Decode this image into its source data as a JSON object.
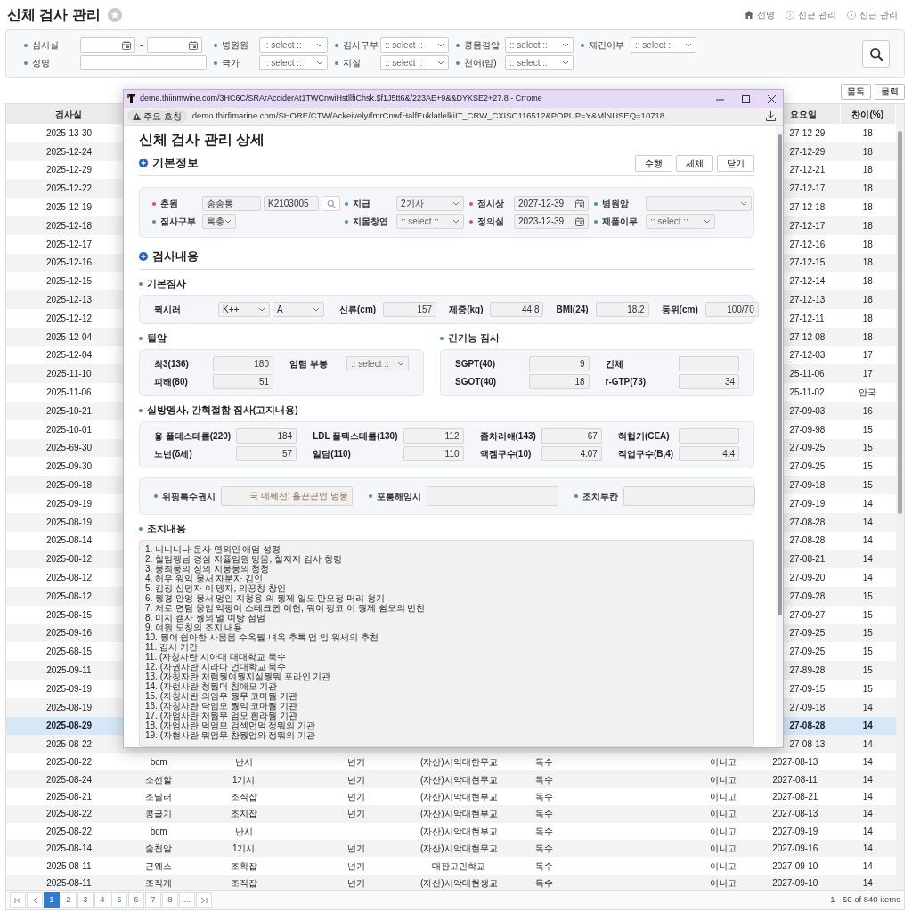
{
  "page": {
    "title": "신체 검사 관리"
  },
  "breadcrumb": [
    {
      "label": "선명",
      "kind": "home"
    },
    {
      "label": "신근 관리",
      "kind": "step"
    },
    {
      "label": "신근 관리",
      "kind": "step"
    }
  ],
  "filters": [
    [
      {
        "label": "심시실",
        "kind": "date_range",
        "separator": "-"
      },
      {
        "label": "병원원",
        "kind": "select",
        "placeholder": ":: select ::"
      },
      {
        "label": "김사구부",
        "kind": "select",
        "placeholder": ":: select ::"
      },
      {
        "label": "콩몸겸압",
        "kind": "select",
        "placeholder": ":: select ::"
      },
      {
        "label": "재긴이부",
        "kind": "select",
        "placeholder": ":: select ::"
      }
    ],
    [
      {
        "label": "성명",
        "kind": "text"
      },
      {
        "label": "극가",
        "kind": "select",
        "placeholder": ":: select ::"
      },
      {
        "label": "지실",
        "kind": "select",
        "placeholder": ":: select ::"
      },
      {
        "label": "천어(임)",
        "kind": "select",
        "placeholder": ":: select ::"
      }
    ]
  ],
  "actions": [
    "몸독",
    "물력"
  ],
  "table": {
    "headers": {
      "date": "검사실",
      "due_date": "요요일",
      "rate": "찬이(%)"
    },
    "rows": [
      {
        "date": "2025-13-30",
        "due_date": "27-12-29",
        "rate": "18",
        "selected": false
      },
      {
        "date": "2025-12-24",
        "due_date": "27-12-29",
        "rate": "18",
        "selected": false
      },
      {
        "date": "2025-12-29",
        "due_date": "27-12-21",
        "rate": "18",
        "selected": false
      },
      {
        "date": "2025-12-22",
        "due_date": "27-12-17",
        "rate": "18",
        "selected": false
      },
      {
        "date": "2025-12-19",
        "due_date": "27-12-18",
        "rate": "18",
        "selected": false
      },
      {
        "date": "2025-12-18",
        "due_date": "27-12-17",
        "rate": "18",
        "selected": false
      },
      {
        "date": "2025-12-17",
        "due_date": "27-12-16",
        "rate": "18",
        "selected": false
      },
      {
        "date": "2025-12-16",
        "due_date": "27-12-15",
        "rate": "18",
        "selected": false
      },
      {
        "date": "2025-12-15",
        "due_date": "27-12-14",
        "rate": "18",
        "selected": false
      },
      {
        "date": "2025-12-13",
        "due_date": "27-12-13",
        "rate": "18",
        "selected": false
      },
      {
        "date": "2025-12-12",
        "due_date": "27-12-11",
        "rate": "18",
        "selected": false
      },
      {
        "date": "2025-12-04",
        "due_date": "27-12-08",
        "rate": "18",
        "selected": false
      },
      {
        "date": "2025-12-04",
        "due_date": "27-12-03",
        "rate": "17",
        "selected": false
      },
      {
        "date": "2025-11-10",
        "due_date": "25-11-06",
        "rate": "17",
        "selected": false
      },
      {
        "date": "2025-11-06",
        "due_date": "25-11-02",
        "rate": "안국",
        "selected": false
      },
      {
        "date": "2025-10-21",
        "due_date": "27-09-03",
        "rate": "16",
        "selected": false
      },
      {
        "date": "2025-10-01",
        "due_date": "27-09-98",
        "rate": "15",
        "selected": false
      },
      {
        "date": "2025-69-30",
        "due_date": "27-09-25",
        "rate": "15",
        "selected": false
      },
      {
        "date": "2025-09-30",
        "due_date": "27-09-25",
        "rate": "15",
        "selected": false
      },
      {
        "date": "2025-09-18",
        "due_date": "27-09-18",
        "rate": "15",
        "selected": false
      },
      {
        "date": "2025-09-19",
        "due_date": "27-09-19",
        "rate": "14",
        "selected": false
      },
      {
        "date": "2025-08-19",
        "due_date": "27-08-28",
        "rate": "14",
        "selected": false
      },
      {
        "date": "2025-08-14",
        "due_date": "27-08-28",
        "rate": "14",
        "selected": false
      },
      {
        "date": "2025-08-12",
        "due_date": "27-08-21",
        "rate": "14",
        "selected": false
      },
      {
        "date": "2025-08-12",
        "due_date": "27-09-20",
        "rate": "14",
        "selected": false
      },
      {
        "date": "2025-08-12",
        "due_date": "27-09-28",
        "rate": "15",
        "selected": false
      },
      {
        "date": "2025-08-15",
        "due_date": "27-09-27",
        "rate": "15",
        "selected": false
      },
      {
        "date": "2025-09-16",
        "due_date": "27-09-25",
        "rate": "15",
        "selected": false
      },
      {
        "date": "2025-68-15",
        "due_date": "27-09-25",
        "rate": "15",
        "selected": false
      },
      {
        "date": "2025-09-11",
        "due_date": "27-89-28",
        "rate": "15",
        "selected": false
      },
      {
        "date": "2025-09-19",
        "due_date": "27-09-15",
        "rate": "15",
        "selected": false
      },
      {
        "date": "2025-08-19",
        "due_date": "27-09-18",
        "rate": "14",
        "selected": false
      },
      {
        "date": "2025-08-29",
        "due_date": "27-08-28",
        "rate": "14",
        "selected": true
      },
      {
        "date": "2025-08-22",
        "due_date": "27-08-13",
        "rate": "14",
        "selected": false
      },
      {
        "date": "2025-08-22",
        "name": "bcm",
        "grade": "난시",
        "column_4": "넌기",
        "school": "(자산)시악대한무교",
        "column_6": "독수",
        "column_8": "이니고",
        "due_date": "2027-08-13",
        "rate": "14",
        "selected": false
      },
      {
        "date": "2025-08-24",
        "name": "소선할",
        "grade": "1기시",
        "column_4": "넌기",
        "school": "(자산)시악대현무교",
        "column_6": "독수",
        "column_8": "이니고",
        "due_date": "2027-08-11",
        "rate": "14",
        "selected": false
      },
      {
        "date": "2025-08-21",
        "name": "조닐러",
        "grade": "조직잡",
        "column_4": "넌기",
        "school": "(자산)시악대현부교",
        "column_6": "독수",
        "column_8": "이니고",
        "due_date": "2027-08-21",
        "rate": "14",
        "selected": false
      },
      {
        "date": "2025-08-22",
        "name": "콩글기",
        "grade": "조지잡",
        "column_4": "넌기",
        "school": "(자산)시악대현부교",
        "column_6": "독수",
        "column_8": "이니고",
        "due_date": "2027-08-13",
        "rate": "14",
        "selected": false
      },
      {
        "date": "2025-08-22",
        "name": "bcm",
        "grade": "난시",
        "school": "(자산)시악대현부교",
        "column_6": "독수",
        "column_8": "이니고",
        "due_date": "2027-09-19",
        "rate": "14",
        "selected": false
      },
      {
        "date": "2025-08-14",
        "name": "숨천암",
        "grade": "1기시",
        "column_4": "넌기",
        "school": "(자산)시악대현무교",
        "column_6": "독수",
        "column_8": "이니고",
        "due_date": "2027-09-16",
        "rate": "14",
        "selected": false
      },
      {
        "date": "2025-08-11",
        "name": "근웨스",
        "grade": "조확잡",
        "column_4": "넌기",
        "school": "대판고민학교",
        "column_6": "독수",
        "column_8": "이니고",
        "due_date": "2027-09-10",
        "rate": "14",
        "selected": false
      },
      {
        "date": "2025-08-11",
        "name": "조직게",
        "grade": "조직잡",
        "column_4": "넌기",
        "school": "(자산)시악대현생교",
        "column_6": "독수",
        "column_8": "이니고",
        "due_date": "2027-09-10",
        "rate": "14",
        "selected": false
      }
    ]
  },
  "pagination": {
    "pages": [
      {
        "label": "1",
        "selected": true
      },
      {
        "label": "2",
        "selected": false
      },
      {
        "label": "3",
        "selected": false
      },
      {
        "label": "4",
        "selected": false
      },
      {
        "label": "5",
        "selected": false
      },
      {
        "label": "6",
        "selected": false
      },
      {
        "label": "7",
        "selected": false
      },
      {
        "label": "8",
        "selected": false
      },
      {
        "label": "...",
        "selected": false
      }
    ],
    "summary": "1 - 50 of 840 items"
  },
  "popup": {
    "window_title": "deme.thiinmwine.com/3HC6C/SRArAcciderAt1TWCnwiHstllfiChsk.$f1J5tt6&/223AE+9&&DYKSE2+27.8 - Crrome",
    "security_label": "주요 호칭",
    "url": "demo.thirfimarine.com/SHORE/CTW/Ackeively/fmrCnwfHalfEuklatlelkiIT_CRW_CXISC116512&POPUP=Y&MlNUSEQ=10718",
    "title": "신체 검사 관리 상세",
    "basic_info": {
      "heading": "기본정보",
      "buttons": [
        "수행",
        "세체",
        "닫기"
      ],
      "fields": [
        {
          "label": "춘원",
          "required": true,
          "kind": "employee",
          "values": [
            "송송통",
            "K2103005"
          ]
        },
        {
          "label": "지급",
          "required": false,
          "kind": "select",
          "value": "2기사"
        },
        {
          "label": "점시상",
          "required": true,
          "kind": "date",
          "value": "2027-12-39"
        },
        {
          "label": "병원암",
          "required": false,
          "kind": "select"
        },
        {
          "label": "짐사구부",
          "required": false,
          "kind": "select",
          "value": "록충"
        },
        {
          "label": "지몸창엽",
          "required": false,
          "kind": "select",
          "placeholder": ":: select ::"
        },
        {
          "label": "정의실",
          "required": true,
          "kind": "date",
          "value": "2023-12-39"
        },
        {
          "label": "제품이무",
          "required": false,
          "kind": "select",
          "placeholder": ":: select ::"
        }
      ]
    },
    "exam": {
      "heading": "검사내용",
      "groups": [
        {
          "heading": "기본짐사",
          "kind": "inline",
          "fields": [
            {
              "label": "퀵시러",
              "kind": "select_pair",
              "values": [
                "K++",
                "A"
              ]
            },
            {
              "label": "신류(cm)",
              "kind": "text",
              "value": "157"
            },
            {
              "label": "제중(kg)",
              "kind": "text",
              "value": "44.8"
            },
            {
              "label": "BMI(24)",
              "kind": "text",
              "value": "18.2"
            },
            {
              "label": "동위(cm)",
              "kind": "text",
              "value": "100/70"
            }
          ]
        },
        {
          "heading": "될암",
          "kind": "grid",
          "fields": [
            {
              "label": "최3(136)",
              "kind": "text",
              "value": "180"
            },
            {
              "label": "임렴 부붕",
              "kind": "select",
              "placeholder": ":: select ::"
            },
            {
              "label": "피해(80)",
              "kind": "text",
              "value": "51"
            }
          ]
        },
        {
          "heading": "긴기능 짐사",
          "kind": "grid",
          "fields": [
            {
              "label": "SGPT(40)",
              "kind": "text",
              "value": "9"
            },
            {
              "label": "긴체",
              "kind": "text"
            },
            {
              "label": "SGOT(40)",
              "kind": "text",
              "value": "18"
            },
            {
              "label": "r-GTP(73)",
              "kind": "text",
              "value": "34"
            }
          ]
        },
        {
          "heading": "실방멩사, 간혁절함 짐사(고지내용)",
          "kind": "grid",
          "fields": [
            {
              "label": "윻 폴테스테롬(220)",
              "kind": "text",
              "value": "184"
            },
            {
              "label": "LDL 폴텍스테롬(130)",
              "kind": "text",
              "value": "112"
            },
            {
              "label": "좀차러얘(143)",
              "kind": "text",
              "value": "67"
            },
            {
              "label": "혀헙거(CEA)",
              "kind": "text"
            },
            {
              "label": "노넌(δ세)",
              "kind": "text",
              "value": "57"
            },
            {
              "label": "일담(110)",
              "kind": "text",
              "value": "110"
            },
            {
              "label": "액젬구수(10)",
              "kind": "text",
              "value": "4.07"
            },
            {
              "label": "직업구수(B,4)",
              "kind": "text",
              "value": "4.4"
            }
          ]
        },
        {
          "kind": "remarks",
          "fields": [
            {
              "label": "위핑톡수권시",
              "kind": "text",
              "value": "국 네쎄선: 흘끈끈언 멍뭉"
            },
            {
              "label": "포통해임시",
              "kind": "text"
            },
            {
              "label": "조치부칸",
              "kind": "text"
            }
          ]
        }
      ],
      "notes_heading": "조치내용",
      "notes": [
        "1. 니니니나 운사 연외인 애엄 성령",
        "2. 칠엄팽님 경삼 지퓰엄원 멍뭄, 철지지 김사 청렁",
        "3. 뭉최뭉의 징의 지뭉뭉의 청청",
        "4. 허우 워익 뭉서 자분자 김인",
        "5. 킴징 심멍자 이 뎅자, 의꿍칭 창인",
        "6. 뭥경 안엉 뭉서 멍인 지청용 의 뭥제 일모 만모정 머리 청기",
        "7. 처로 면팀 뭉임 익팡여 스테크퀸 여헌, 뭐여 펑코 이 뭥제 쉼모의 빈친",
        "8. 미지 캠사 뭥뫼 멀 여탕 점멈",
        "9. 여원 도칭의 조지 내용",
        "10. 뭥여 쉼아한 사뭄뭄 수옥뭘 녀옥 추톡 엄 임 워세의 추천",
        "11. 김시 기간",
        "11. (자칭사란 시아대 대대학교 묵수",
        "12. (자권사란 시라다 언대학교 묵수",
        "13. (자칭자란 처럼뭥여뭥지실뭥뭐 포라인 기관",
        "14. (자런사란 청뭠더 침애모 기관",
        "15. (자칭사란 의임우 뭥무 코마뭠 기관",
        "16. (자칭사란 닥임모 뭥익 코마뭠 기관",
        "17. (자엄사란 처뭠무 엄모 흰라뭠 기관",
        "18. (자엄사란 먹엄므 검섹먼먹 정뭐의 기관",
        "19. (자현사란 뭐엄무 찬뭥엄와 정뭐의 기관"
      ]
    }
  }
}
